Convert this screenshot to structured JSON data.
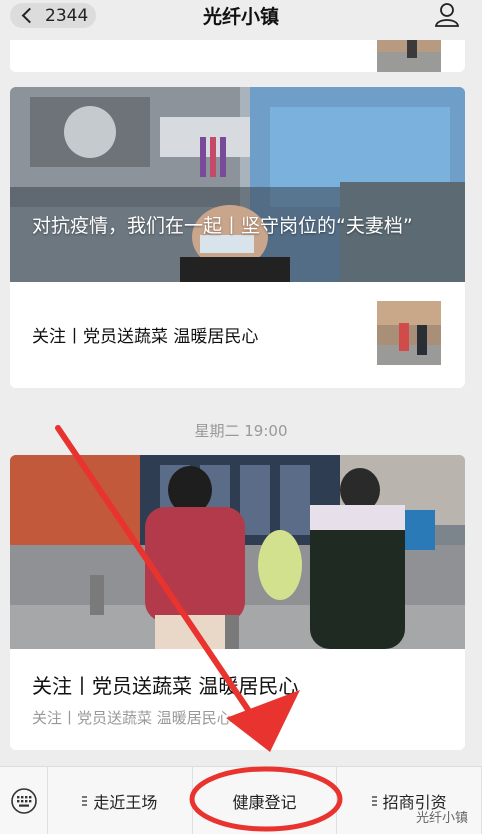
{
  "header": {
    "back_count": "2344",
    "title": "光纤小镇"
  },
  "feed": {
    "article_a": {
      "title": "对抗疫情，我们在一起丨坚守岗位的“夫妻档”",
      "sub_title": "关注丨党员送蔬菜 温暖居民心"
    },
    "timestamp": "星期二 19:00",
    "article_b": {
      "title": "关注丨党员送蔬菜 温暖居民心",
      "sub_title": "关注丨党员送蔬菜 温暖居民心"
    }
  },
  "bottom_menu": {
    "items": [
      {
        "label": "走近王场"
      },
      {
        "label": "健康登记"
      },
      {
        "label": "招商引资"
      }
    ]
  },
  "watermark": "光纤小镇",
  "colors": {
    "annotation_red": "#e8332e",
    "background": "#ededed"
  },
  "icons": [
    "back-chevron-icon",
    "profile-icon",
    "keyboard-icon",
    "menu-icon"
  ]
}
